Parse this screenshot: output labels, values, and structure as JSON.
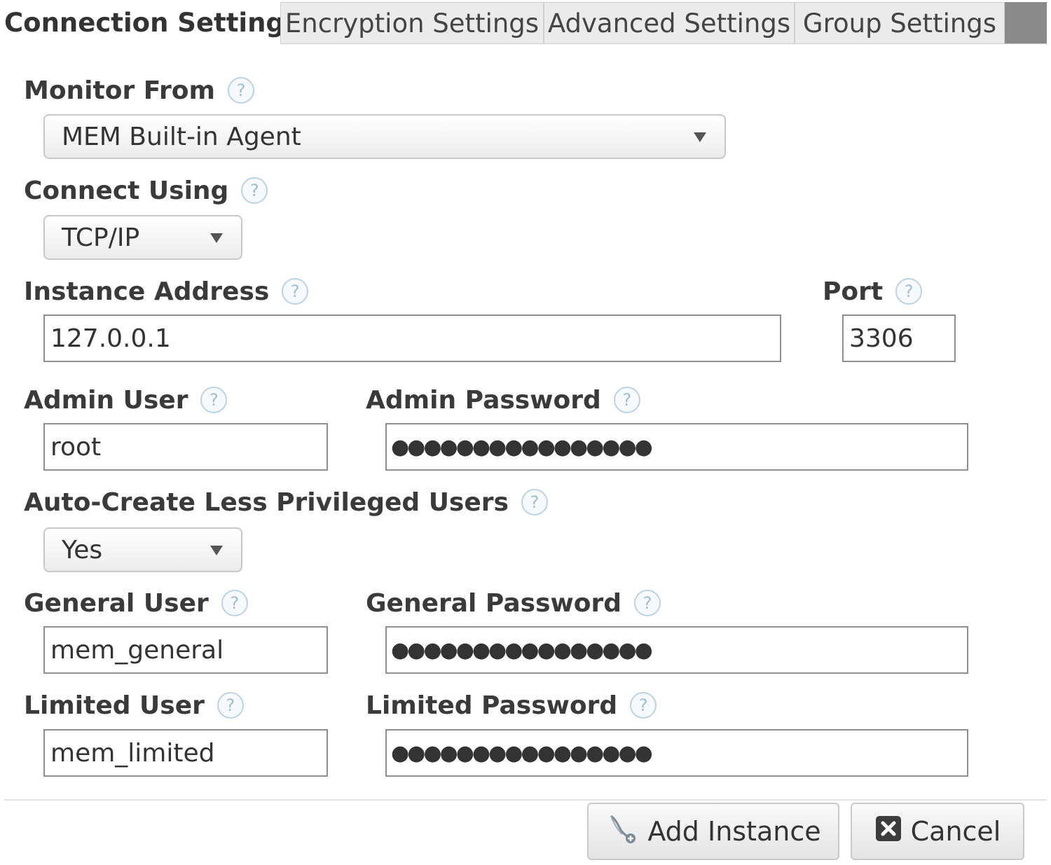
{
  "tabs": [
    {
      "label": "Connection Settings",
      "active": true
    },
    {
      "label": "Encryption Settings",
      "active": false
    },
    {
      "label": "Advanced Settings",
      "active": false
    },
    {
      "label": "Group Settings",
      "active": false
    }
  ],
  "help_glyph": "?",
  "monitor_from": {
    "label": "Monitor From",
    "value": "MEM Built-in Agent"
  },
  "connect_using": {
    "label": "Connect Using",
    "value": "TCP/IP"
  },
  "instance_address": {
    "label": "Instance Address",
    "value": "127.0.0.1"
  },
  "port": {
    "label": "Port",
    "value": "3306"
  },
  "admin_user": {
    "label": "Admin User",
    "value": "root"
  },
  "admin_password": {
    "label": "Admin Password",
    "value": "●●●●●●●●●●●●●●●●"
  },
  "auto_create": {
    "label": "Auto-Create Less Privileged Users",
    "value": "Yes"
  },
  "general_user": {
    "label": "General User",
    "value": "mem_general"
  },
  "general_password": {
    "label": "General Password",
    "value": "●●●●●●●●●●●●●●●●"
  },
  "limited_user": {
    "label": "Limited User",
    "value": "mem_limited"
  },
  "limited_password": {
    "label": "Limited Password",
    "value": "●●●●●●●●●●●●●●●●"
  },
  "buttons": {
    "add_instance": "Add Instance",
    "cancel": "Cancel"
  },
  "colors": {
    "help_ring": "#bcd3e6",
    "tab_bg": "#ebebeb",
    "tab_filler": "#8a8a8a"
  }
}
